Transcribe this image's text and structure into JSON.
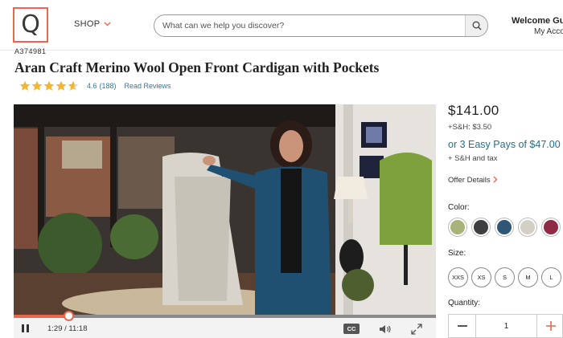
{
  "header": {
    "logo_letter": "Q",
    "shop_label": "SHOP",
    "search_placeholder": "What can we help you discover?",
    "welcome": "Welcome Gu",
    "account": "My Acco"
  },
  "product": {
    "item_number": "A374981",
    "title": "Aran Craft Merino Wool Open Front Cardigan with Pockets",
    "rating": "4.6",
    "rating_value": 4.6,
    "review_count": "(188)",
    "read_reviews": "Read Reviews"
  },
  "video": {
    "time": "1:29 / 11:18",
    "progress": 0.13,
    "cc_label": "CC"
  },
  "purchase": {
    "price": "$141.00",
    "shipping": "+S&H: $3.50",
    "easy_pay": "or 3 Easy Pays of $47.00",
    "shipping_tax": "+ S&H and tax",
    "offer_details": "Offer Details",
    "color_label": "Color:",
    "colors": [
      "#a8b37a",
      "#3e3e40",
      "#2f5577",
      "#d3cfc3",
      "#8f2b44"
    ],
    "size_label": "Size:",
    "sizes": [
      "XXS",
      "XS",
      "S",
      "M",
      "L"
    ],
    "quantity_label": "Quantity:",
    "quantity": "1"
  },
  "colors": {
    "accent": "#e8674f",
    "link": "#2a7d9c",
    "star": "#f2b632"
  }
}
